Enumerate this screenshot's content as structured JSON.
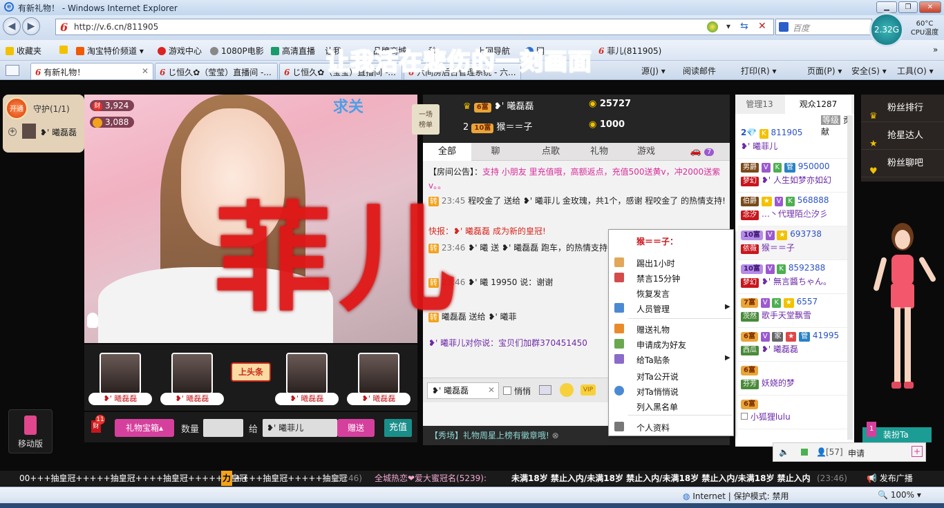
{
  "window": {
    "title": "有新礼物！ - Windows Internet Explorer"
  },
  "address": {
    "url": "http://v.6.cn/811905",
    "search_placeholder": "百度"
  },
  "system": {
    "net_speed": "2.32G",
    "cpu_temp": "60°C",
    "cpu_label": "CPU温度"
  },
  "favorites": {
    "label": "收藏夹",
    "items": [
      "淘宝特价频道 ▾",
      "游戏中心",
      "1080P电影",
      "高清直播",
      "让我",
      "品牌商城",
      "秒",
      "上网导航",
      "网",
      "菲儿(811905)"
    ]
  },
  "tabs": [
    {
      "label": "有新礼物！"
    },
    {
      "label": "じ恒久✿（莹莹）直播间 -..."
    },
    {
      "label": "じ恒久✿（莹莹）直播间 -..."
    },
    {
      "label": "六间房后台管理系统 - 六..."
    }
  ],
  "commandbar": [
    "源(J) ▾",
    "阅读邮件",
    "打印(R) ▾",
    "页面(P) ▾",
    "安全(S) ▾",
    "工具(O) ▾"
  ],
  "overlay_caption": "让我活在悲伤的一刻画面",
  "roses_text": "菲儿",
  "guard": {
    "open_label": "开通",
    "title": "守护(1/1)",
    "member": "❥' 曦磊磊"
  },
  "video": {
    "fortune": "3,924",
    "fortune_icon": "财",
    "second": "3,088",
    "qiu_text": "求关"
  },
  "gift_row": {
    "names": [
      "❥' 曦磊磊",
      "❥' 曦磊磊",
      "❥' 曦磊磊",
      "❥' 曦磊磊"
    ],
    "toutiao": "上头条"
  },
  "giftbar": {
    "box_label": "礼物宝箱▴",
    "qty_label": "数量",
    "to_label": "给",
    "to_value": "❥' 曦菲儿",
    "send_label": "赠送",
    "recharge_label": "充值",
    "badge_count": "11",
    "badge_icon": "财"
  },
  "mobile": {
    "label": "移动版"
  },
  "rank": [
    {
      "pos": "",
      "level": "6富",
      "name": "❥' 曦磊磊",
      "coins": "25727"
    },
    {
      "pos": "2",
      "level": "10富",
      "name": "猴＝＝子",
      "coins": "1000"
    }
  ],
  "chat": {
    "tabs": [
      "全部",
      "聊",
      "点歌",
      "礼物",
      "游戏"
    ],
    "car_count": "7",
    "announce_prefix": "【房间公告】：",
    "announce_text": "支持 小朋友 里充值哦，高额返点，充值500送黄v，冲2000送紫v。。",
    "msgs": [
      {
        "badge": "转",
        "time": "23:45",
        "text": "程咬金了 送给 ❥' 曦菲儿 金玫瑰，共1个，感谢 程咬金了 的热情支持!"
      },
      {
        "badge": "",
        "time": "",
        "text": "快报：❥' 曦磊磊 成为新的皇冠!"
      },
      {
        "badge": "转",
        "time": "23:46",
        "text": "❥' 曦 送 ❥' 曦磊磊 跑车，的热情支持!"
      },
      {
        "badge": "转",
        "time": "23:46",
        "text": "❥' 曦 19950 说：谢谢"
      },
      {
        "badge": "转",
        "time": "",
        "text": "曦磊磊 送给 ❥' 曦菲"
      },
      {
        "badge": "",
        "time": "",
        "text": "❥' 曦菲儿对你说：宝贝们加群370451450"
      }
    ],
    "target": "❥' 曦磊磊",
    "whisper_label": "悄悄",
    "ticker": "【秀场】礼物周星上榜有徽章哦!"
  },
  "context_menu": {
    "header": "猴＝＝子：",
    "items": [
      "踢出1小时",
      "禁言15分钟",
      "恢复发言",
      "人员管理",
      "赠送礼物",
      "申请成为好友",
      "给Ta贴条",
      "对Ta公开说",
      "对Ta悄悄说",
      "列入黑名单",
      "个人资料"
    ]
  },
  "userlist": {
    "tab_admin": "管理13",
    "tab_audience": "观众1287",
    "sub_level": "等级",
    "sub_contrib": "贡献",
    "users": [
      {
        "level": "2",
        "fam": "",
        "id": "811905",
        "name": "❥' 曦菲儿"
      },
      {
        "level": "男爵",
        "fam": "梦幻",
        "id": "950000",
        "name": "❥' 人生如梦亦如幻"
      },
      {
        "level": "伯爵",
        "fam": "念汐",
        "id": "568888",
        "name": "…丶代理陌尐汐彡"
      },
      {
        "level": "10富",
        "fam": "依薇",
        "id": "693738",
        "name": "猴＝＝子"
      },
      {
        "level": "10富",
        "fam": "梦幻",
        "id": "8592388",
        "name": "❥' 無言醬ちゃん。"
      },
      {
        "level": "7富",
        "fam": "茨然",
        "id": "6557",
        "name": "歌手天堂飘雪"
      },
      {
        "level": "6富",
        "fam": "西瓜",
        "id": "41995",
        "name": "❥' 曦磊磊"
      },
      {
        "level": "6富",
        "fam": "芬芳",
        "id": "",
        "name": "妖娆的梦"
      },
      {
        "level": "6富",
        "fam": "",
        "id": "",
        "name": "小狐狸lulu"
      }
    ]
  },
  "rightnav": [
    "粉丝排行",
    "抢星达人",
    "粉丝聊吧"
  ],
  "dressup": {
    "label": "装扮Ta",
    "count": "1"
  },
  "applybar": {
    "count": "[57]",
    "apply": "申请"
  },
  "scrolling": {
    "left": "00+++抽皇冠+++++抽皇冠++++抽皇冠+++++抽皇冠",
    "mid1": "力",
    "mid2": "++++抽皇冠+++++抽皇冠",
    "time1": "(23:46)",
    "center": "全城热恋❤爱大蜜冠名(5239):",
    "right": "未满18岁 禁止入内/未满18岁 禁止入内/未满18岁 禁止入内/未满18岁 禁止入内",
    "time2": "(23:46)",
    "broadcast": "发布广播"
  },
  "status": {
    "zone": "Internet | 保护模式: 禁用",
    "zoom": "100%"
  },
  "colors": {
    "accent_pink": "#d5409d",
    "teal": "#1a8f8a",
    "chrome_blue": "#cddcef"
  }
}
